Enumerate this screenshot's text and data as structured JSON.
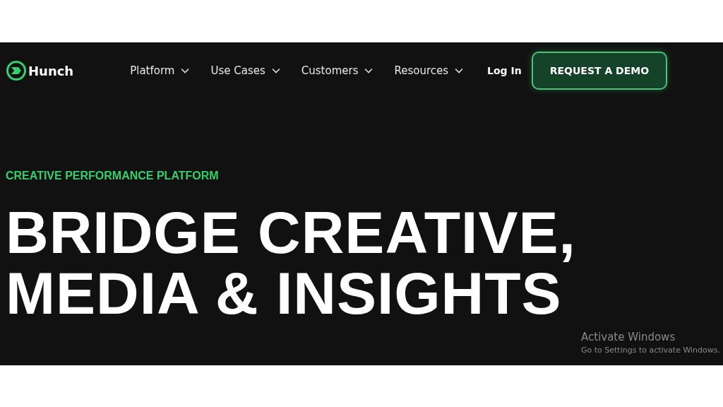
{
  "nav": {
    "logo": "Hunch",
    "items": [
      {
        "label": "Platform"
      },
      {
        "label": "Use Cases"
      },
      {
        "label": "Customers"
      },
      {
        "label": "Resources"
      }
    ],
    "login": "Log In",
    "cta": "REQUEST A DEMO"
  },
  "hero": {
    "eyebrow": "CREATIVE PERFORMANCE PLATFORM",
    "heading_lines": [
      "BRIDGE CREATIVE,",
      "MEDIA & INSIGHTS"
    ]
  },
  "os_notice": {
    "title": "Activate Windows",
    "subtitle": "Go to Settings to activate Windows."
  }
}
